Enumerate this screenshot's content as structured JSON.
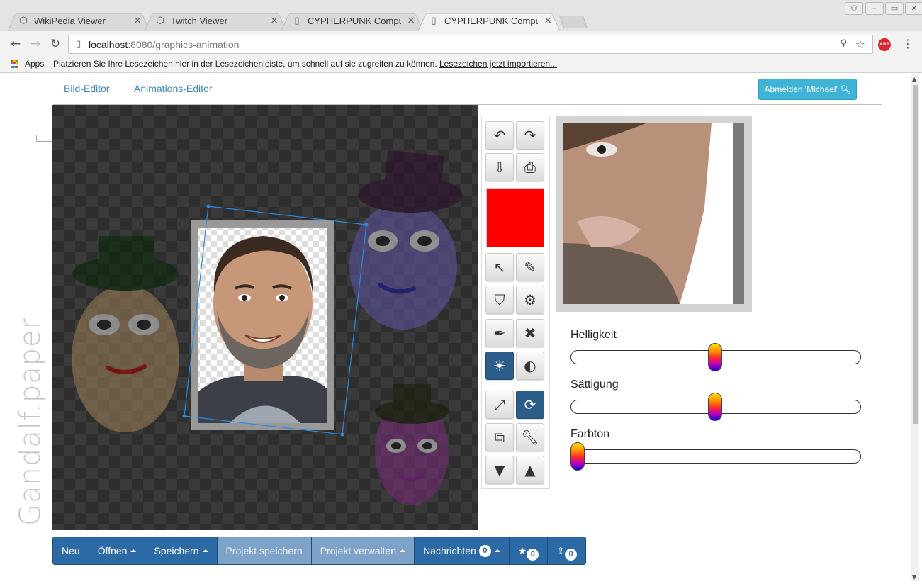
{
  "browser": {
    "tabs": [
      {
        "title": "WikiPedia Viewer",
        "icon": "codepen-icon",
        "active": false
      },
      {
        "title": "Twitch Viewer",
        "icon": "codepen-icon",
        "active": false
      },
      {
        "title": "CYPHERPUNK Compute",
        "icon": "page-icon",
        "active": false
      },
      {
        "title": "CYPHERPUNK Compute",
        "icon": "page-icon",
        "active": true
      }
    ],
    "url_host": "localhost",
    "url_rest": ":8080/graphics-animation",
    "abp_label": "ABP",
    "bookmarks": {
      "apps_label": "Apps",
      "info_text": "Platzieren Sie Ihre Lesezeichen hier in der Lesezeichenleiste, um schnell auf sie zugreifen zu können.",
      "import_link": "Lesezeichen jetzt importieren..."
    }
  },
  "nav": {
    "links": [
      "Bild-Editor",
      "Animations-Editor"
    ],
    "logout_label": "Abmelden 'Michael'"
  },
  "brand": "Gandalf.paper",
  "palette": {
    "color": "#ff0000",
    "tools": [
      "undo-icon",
      "redo-icon",
      "save-icon",
      "save-to-computer-icon",
      "select-arrow-icon",
      "pencil-icon",
      "bookmark-shape-icon",
      "gear-icon",
      "eyedropper-icon",
      "close-icon",
      "brightness-icon",
      "contrast-icon",
      "resize-icon",
      "rotate-icon",
      "copy-icon",
      "wrench-icon",
      "move-down-icon",
      "move-up-icon"
    ]
  },
  "adjustments": {
    "brightness": {
      "label": "Helligkeit",
      "value": 0.5
    },
    "saturation": {
      "label": "Sättigung",
      "value": 0.5
    },
    "hue": {
      "label": "Farbton",
      "value": 0.0
    }
  },
  "bottombar": {
    "new": "Neu",
    "open": "Öffnen",
    "save": "Speichern",
    "save_project": "Projekt speichern",
    "manage_project": "Projekt verwalten",
    "messages": "Nachrichten",
    "messages_count": "0",
    "stars_count": "0",
    "shares_count": "0"
  },
  "colors": {
    "accent": "#2c6aa5",
    "logout": "#3fb3d6",
    "link": "#3a86bd"
  }
}
